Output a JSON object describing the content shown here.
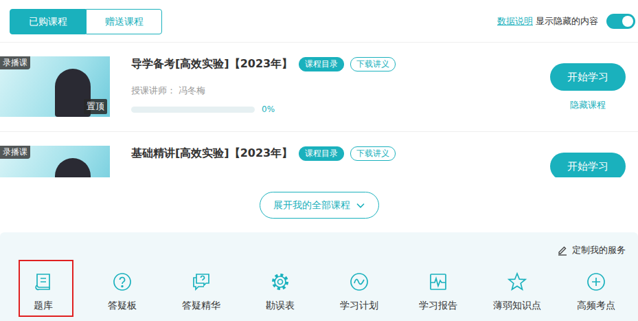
{
  "tabs": [
    {
      "label": "已购课程",
      "selected": true
    },
    {
      "label": "赠送课程",
      "selected": false
    }
  ],
  "header": {
    "data_help": "数据说明",
    "show_hidden_label": "显示隐藏的内容",
    "show_hidden_on": true
  },
  "courses": [
    {
      "badge": "录播课",
      "pinned_label": "置顶",
      "title": "导学备考[高效实验]【2023年】",
      "tags": [
        {
          "label": "课程目录",
          "filled": true
        },
        {
          "label": "下载讲义",
          "filled": false
        }
      ],
      "teacher": "授课讲师： 冯冬梅",
      "progress": {
        "level": 0,
        "reading": "0%"
      },
      "action": "开始学习",
      "hide_action": "隐藏课程"
    },
    {
      "badge": "录播课",
      "title": "基础精讲[高效实验]【2023年】",
      "tags": [
        {
          "label": "课程目录",
          "filled": true
        },
        {
          "label": "下载讲义",
          "filled": false
        }
      ],
      "action": "开始学习"
    }
  ],
  "expand_button": {
    "label": "展开我的全部课程"
  },
  "services": {
    "customize": "定制我的服务",
    "items": [
      {
        "label": "题库",
        "highlighted": true
      },
      {
        "label": "答疑板",
        "highlighted": false
      },
      {
        "label": "答疑精华",
        "highlighted": false
      },
      {
        "label": "勘误表",
        "highlighted": false
      },
      {
        "label": "学习计划",
        "highlighted": false
      },
      {
        "label": "学习报告",
        "highlighted": false
      },
      {
        "label": "薄弱知识点",
        "highlighted": false
      },
      {
        "label": "高频考点",
        "highlighted": false
      }
    ]
  }
}
